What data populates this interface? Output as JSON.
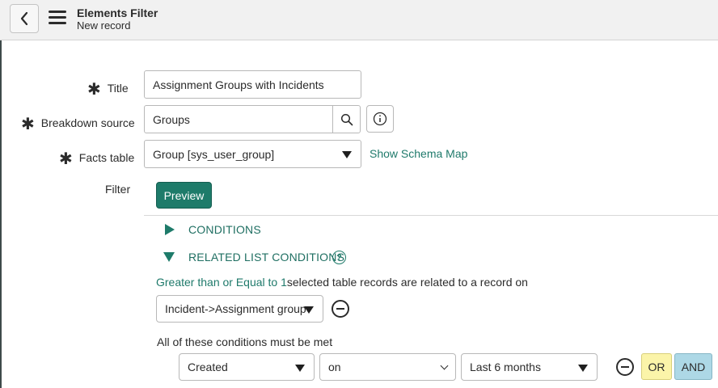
{
  "header": {
    "title": "Elements Filter",
    "subtitle": "New record"
  },
  "form": {
    "title_label": "Title",
    "title_value": "Assignment Groups with Incidents",
    "breakdown_label": "Breakdown source",
    "breakdown_value": "Groups",
    "facts_label": "Facts table",
    "facts_value": "Group [sys_user_group]",
    "schema_link": "Show Schema Map",
    "filter_label": "Filter",
    "preview_label": "Preview"
  },
  "filter": {
    "conditions_label": "CONDITIONS",
    "related_label": "RELATED LIST CONDITIONS",
    "quantity_link": "Greater than or Equal to 1",
    "quantity_text": "selected table records are related to a record on",
    "related_list_value": "Incident->Assignment group",
    "all_conditions_text": "All of these conditions must be met",
    "field_value": "Created",
    "operator_value": "on",
    "date_value": "Last 6 months",
    "or_label": "OR",
    "and_label": "AND"
  },
  "icons": {
    "back": "chevron-left-icon",
    "menu": "hamburger-menu-icon",
    "search": "search-icon",
    "info": "info-icon",
    "help": "help-icon",
    "remove": "minus-circle-icon"
  },
  "colors": {
    "accent": "#1e7b6a",
    "or_button": "#fbf4a9",
    "and_button": "#add8e6"
  }
}
